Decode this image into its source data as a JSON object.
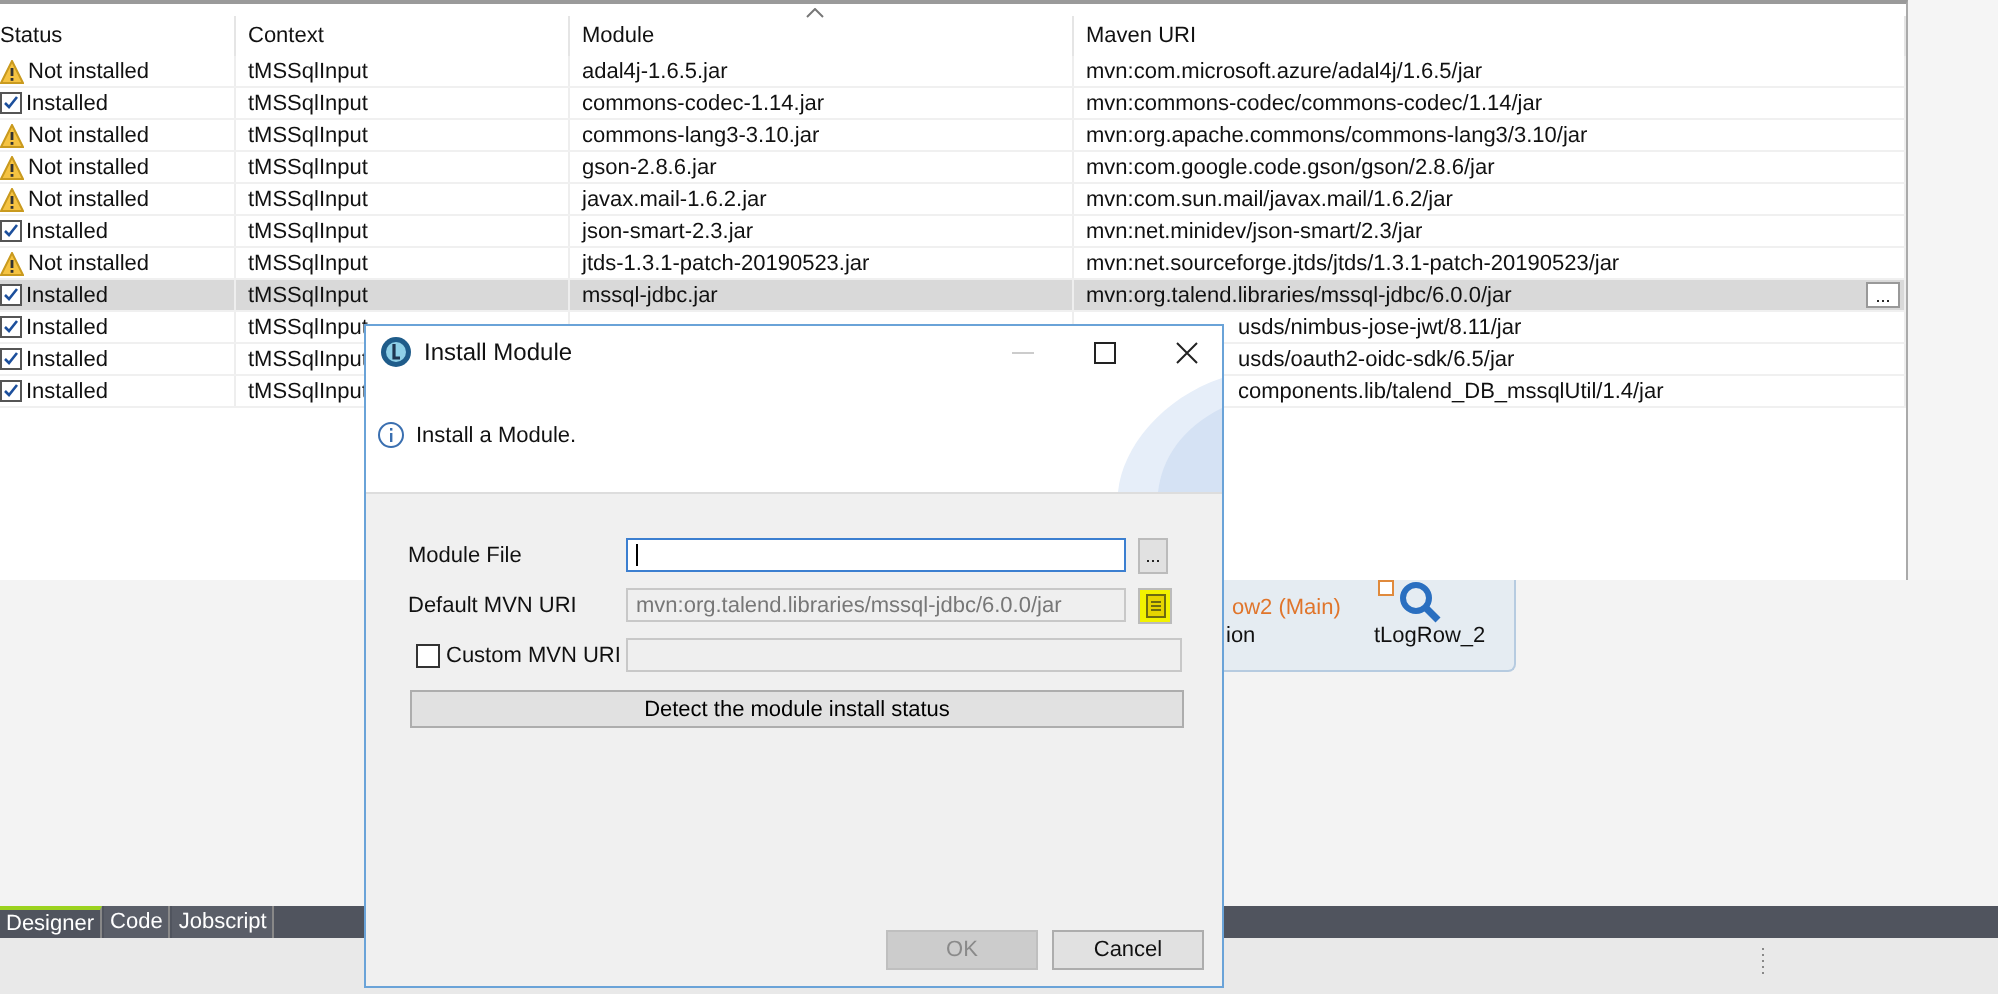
{
  "table": {
    "columns": [
      "Status",
      "Context",
      "Module",
      "Maven URI"
    ],
    "rows": [
      {
        "kind": "warning",
        "status": "Not installed",
        "context": "tMSSqlInput",
        "module": "adal4j-1.6.5.jar",
        "maven": "mvn:com.microsoft.azure/adal4j/1.6.5/jar",
        "selected": false
      },
      {
        "kind": "check",
        "status": "Installed",
        "context": "tMSSqlInput",
        "module": "commons-codec-1.14.jar",
        "maven": "mvn:commons-codec/commons-codec/1.14/jar",
        "selected": false
      },
      {
        "kind": "warning",
        "status": "Not installed",
        "context": "tMSSqlInput",
        "module": "commons-lang3-3.10.jar",
        "maven": "mvn:org.apache.commons/commons-lang3/3.10/jar",
        "selected": false
      },
      {
        "kind": "warning",
        "status": "Not installed",
        "context": "tMSSqlInput",
        "module": "gson-2.8.6.jar",
        "maven": "mvn:com.google.code.gson/gson/2.8.6/jar",
        "selected": false
      },
      {
        "kind": "warning",
        "status": "Not installed",
        "context": "tMSSqlInput",
        "module": "javax.mail-1.6.2.jar",
        "maven": "mvn:com.sun.mail/javax.mail/1.6.2/jar",
        "selected": false
      },
      {
        "kind": "check",
        "status": "Installed",
        "context": "tMSSqlInput",
        "module": "json-smart-2.3.jar",
        "maven": "mvn:net.minidev/json-smart/2.3/jar",
        "selected": false
      },
      {
        "kind": "warning",
        "status": "Not installed",
        "context": "tMSSqlInput",
        "module": "jtds-1.3.1-patch-20190523.jar",
        "maven": "mvn:net.sourceforge.jtds/jtds/1.3.1-patch-20190523/jar",
        "selected": false
      },
      {
        "kind": "check",
        "status": "Installed",
        "context": "tMSSqlInput",
        "module": "mssql-jdbc.jar",
        "maven": "mvn:org.talend.libraries/mssql-jdbc/6.0.0/jar",
        "selected": true,
        "edit_button": "..."
      },
      {
        "kind": "check",
        "status": "Installed",
        "context": "tMSSqlInput",
        "maven": "usds/nimbus-jose-jwt/8.11/jar",
        "selected": false
      },
      {
        "kind": "check",
        "status": "Installed",
        "context": "tMSSqlInput",
        "maven": "usds/oauth2-oidc-sdk/6.5/jar",
        "selected": false
      },
      {
        "kind": "check",
        "status": "Installed",
        "context": "tMSSqlInput",
        "maven": "components.lib/talend_DB_mssqlUtil/1.4/jar",
        "selected": false
      }
    ]
  },
  "canvas": {
    "link_label": "ow2 (Main)",
    "node_label_partial": "ion",
    "node_label": "tLogRow_2"
  },
  "editor_tabs": [
    {
      "label": "Designer",
      "selected": true
    },
    {
      "label": "Code",
      "selected": false
    },
    {
      "label": "Jobscript",
      "selected": false
    }
  ],
  "dialog": {
    "title": "Install Module",
    "message": "Install a Module.",
    "module_file": {
      "label": "Module File",
      "browse": "..."
    },
    "default_uri": {
      "label": "Default MVN URI",
      "value": "mvn:org.talend.libraries/mssql-jdbc/6.0.0/jar"
    },
    "custom_uri": {
      "label": "Custom MVN URI",
      "checked": false
    },
    "detect_button": "Detect the module install status",
    "buttons": [
      {
        "label": "OK",
        "disabled": true
      },
      {
        "label": "Cancel",
        "disabled": false
      }
    ]
  }
}
